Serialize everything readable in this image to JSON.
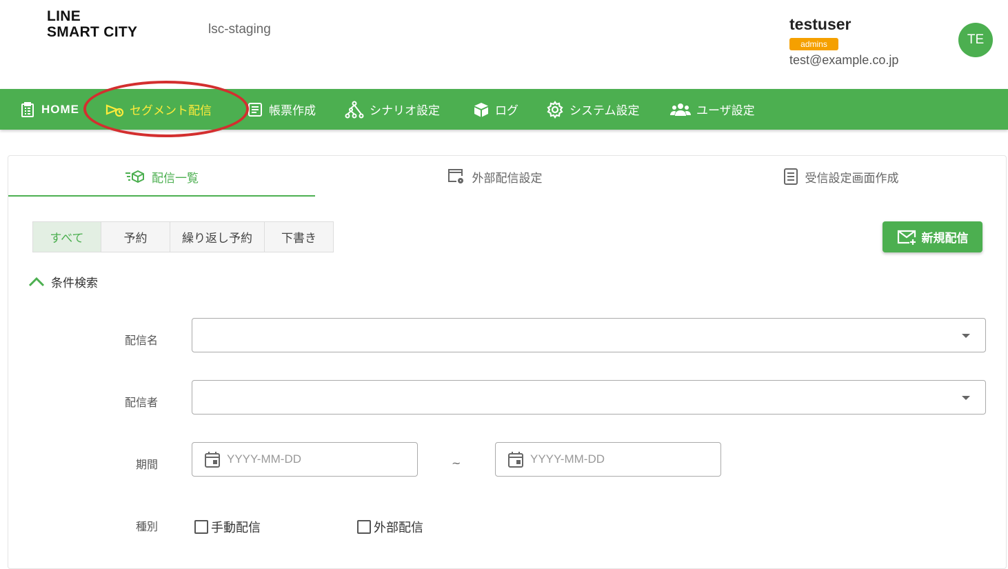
{
  "header": {
    "logo_line1": "LINE",
    "logo_line2": "SMART CITY",
    "environment": "lsc-staging",
    "user": {
      "name": "testuser",
      "role": "admin",
      "role_label": "admins",
      "email": "test@example.co.jp",
      "avatar_initials": "TE"
    }
  },
  "nav": {
    "items": [
      {
        "label": "HOME",
        "icon": "clipboard-icon"
      },
      {
        "label": "セグメント配信",
        "icon": "megaphone-icon",
        "active": true
      },
      {
        "label": "帳票作成",
        "icon": "form-icon"
      },
      {
        "label": "シナリオ設定",
        "icon": "scenario-tree-icon"
      },
      {
        "label": "ログ",
        "icon": "box-icon"
      },
      {
        "label": "システム設定",
        "icon": "gear-icon"
      },
      {
        "label": "ユーザ設定",
        "icon": "users-icon"
      }
    ]
  },
  "tabs": [
    {
      "label": "配信一覧",
      "icon": "delivery-list-icon",
      "active": true
    },
    {
      "label": "外部配信設定",
      "icon": "window-gear-icon"
    },
    {
      "label": "受信設定画面作成",
      "icon": "document-icon"
    }
  ],
  "filters": [
    {
      "label": "すべて",
      "active": true
    },
    {
      "label": "予約"
    },
    {
      "label": "繰り返し予約"
    },
    {
      "label": "下書き"
    }
  ],
  "new_delivery_button": "新規配信",
  "search": {
    "toggle_label": "条件検索",
    "delivery_name_label": "配信名",
    "delivery_name_value": "",
    "sender_label": "配信者",
    "sender_value": "",
    "period_label": "期間",
    "date_from_placeholder": "YYYY-MM-DD",
    "date_to_placeholder": "YYYY-MM-DD",
    "range_separator": "~",
    "type_label": "種別",
    "type_options": [
      {
        "label": "手動配信",
        "checked": false
      },
      {
        "label": "外部配信",
        "checked": false
      }
    ]
  },
  "colors": {
    "primary": "#4caf50",
    "nav_active_text": "#ffeb3b",
    "role_badge": "#f5a000",
    "annotation": "#d32f2f"
  }
}
